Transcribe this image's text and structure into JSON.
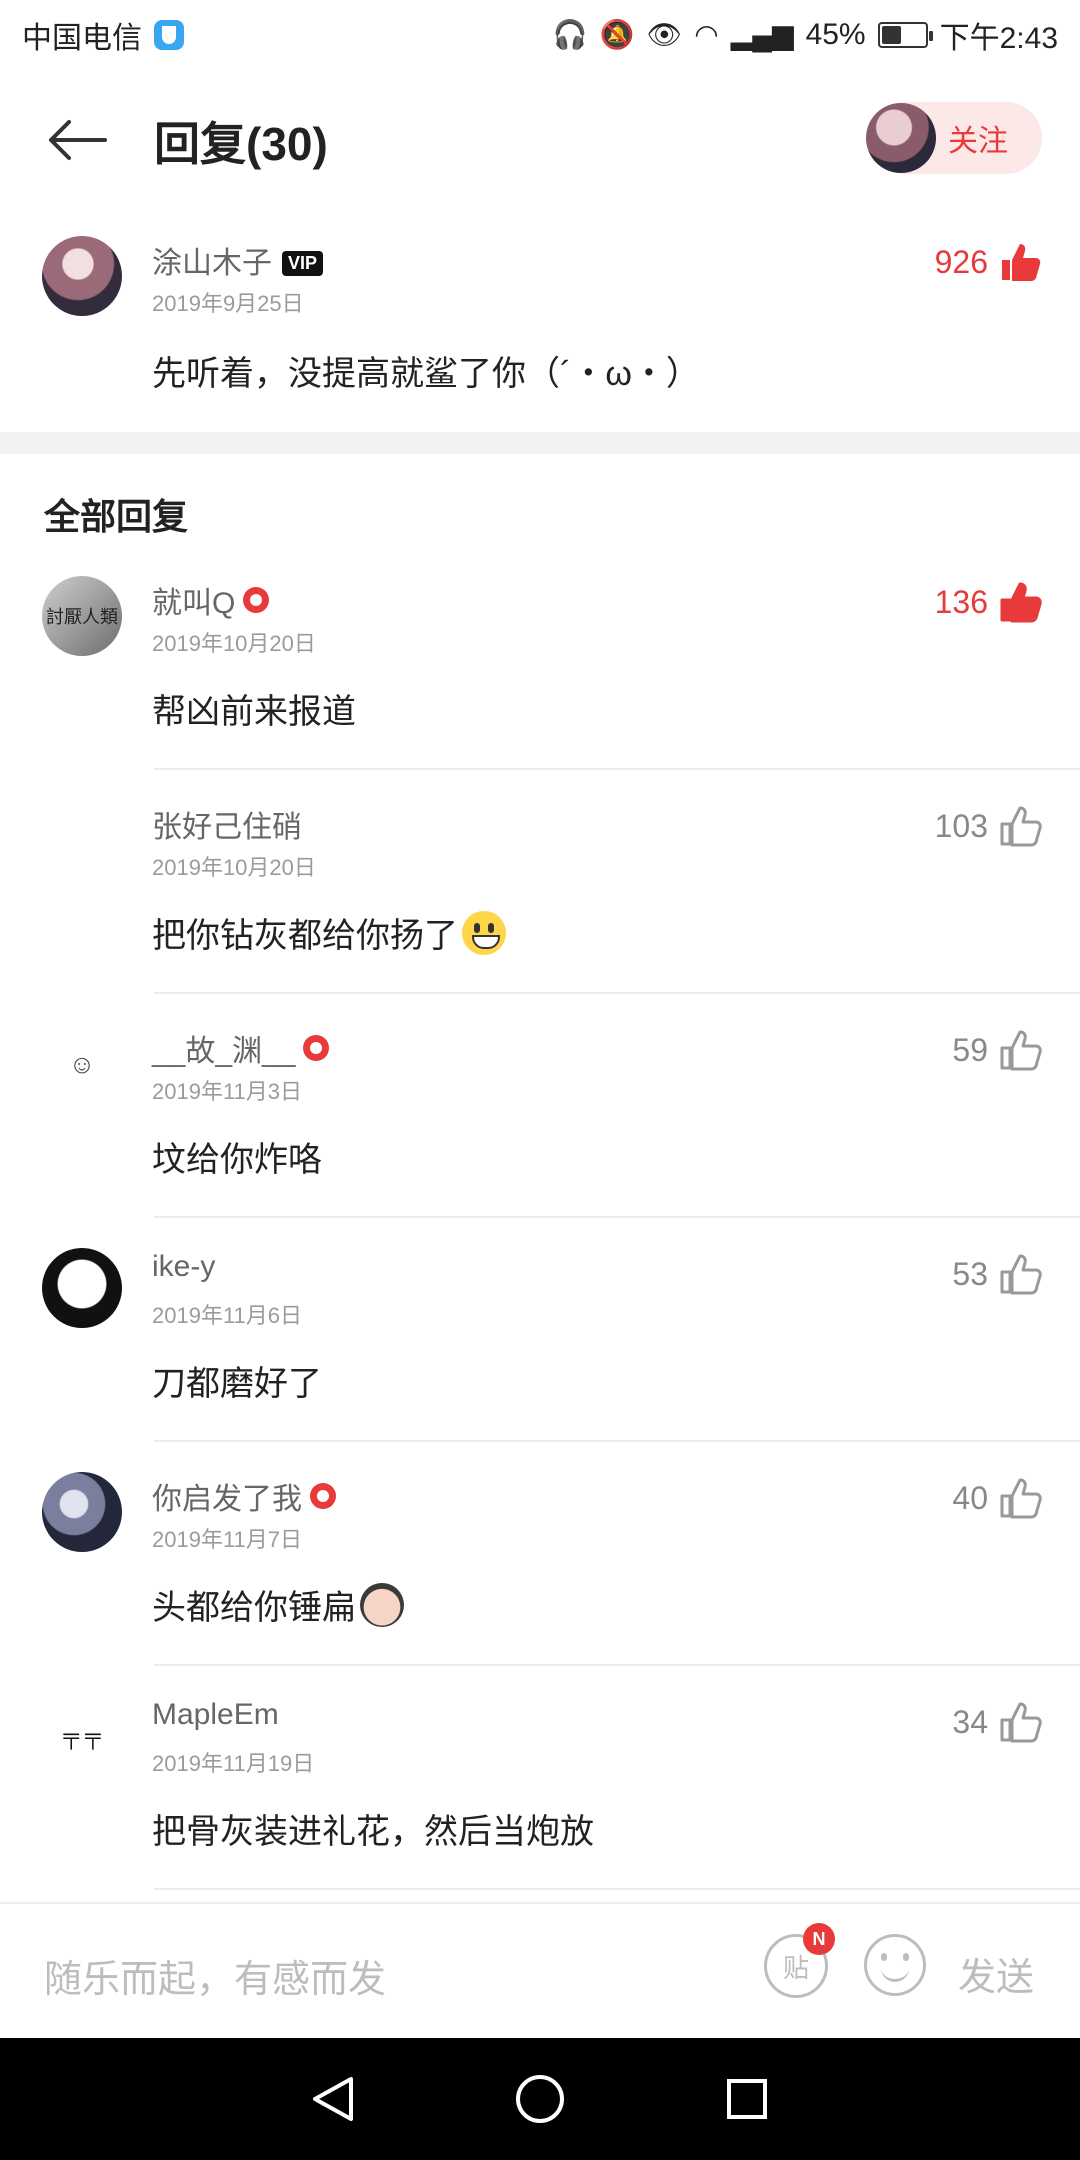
{
  "status_bar": {
    "carrier": "中国电信",
    "battery": "45%",
    "time": "下午2:43",
    "battery_fill": 0.45,
    "icons": [
      "headphones-icon",
      "mute-icon",
      "eye-icon",
      "wifi-icon",
      "signal-icon",
      "battery-icon"
    ]
  },
  "header": {
    "title": "回复(30)",
    "follow_label": "关注"
  },
  "main_comment": {
    "user": "涂山木子",
    "badge": "VIP",
    "date": "2019年9月25日",
    "text": "先听着，没提高就鲨了你（´・ω・）",
    "likes": "926",
    "liked": true
  },
  "section_title": "全部回复",
  "replies": [
    {
      "user": "就叫Q",
      "date": "2019年10月20日",
      "text": "帮凶前来报道",
      "likes": "136",
      "liked": true,
      "verified": true,
      "avatar_text": "討厭人類"
    },
    {
      "user": "张好己住硝",
      "date": "2019年10月20日",
      "text": "把你钻灰都给你扬了",
      "likes": "103",
      "liked": false,
      "verified": false
    },
    {
      "user": "__故_渊__",
      "date": "2019年11月3日",
      "text": "坟给你炸咯",
      "likes": "59",
      "liked": false,
      "verified": true,
      "avatar_text": "☺"
    },
    {
      "user": "ike-y",
      "date": "2019年11月6日",
      "text": "刀都磨好了",
      "likes": "53",
      "liked": false,
      "verified": false
    },
    {
      "user": "你启发了我",
      "date": "2019年11月7日",
      "text": "头都给你锤扁",
      "likes": "40",
      "liked": false,
      "verified": true
    },
    {
      "user": "MapleEm",
      "date": "2019年11月19日",
      "text": "把骨灰装进礼花，然后当炮放",
      "likes": "34",
      "liked": false,
      "verified": false,
      "avatar_text": "╤ ╤"
    }
  ],
  "input_bar": {
    "placeholder": "随乐而起，有感而发",
    "tie_label": "贴",
    "tie_badge": "N",
    "send_label": "发送"
  },
  "colors": {
    "accent": "#e8393b",
    "follow_bg": "#fde8e8",
    "divider": "#ececec"
  }
}
